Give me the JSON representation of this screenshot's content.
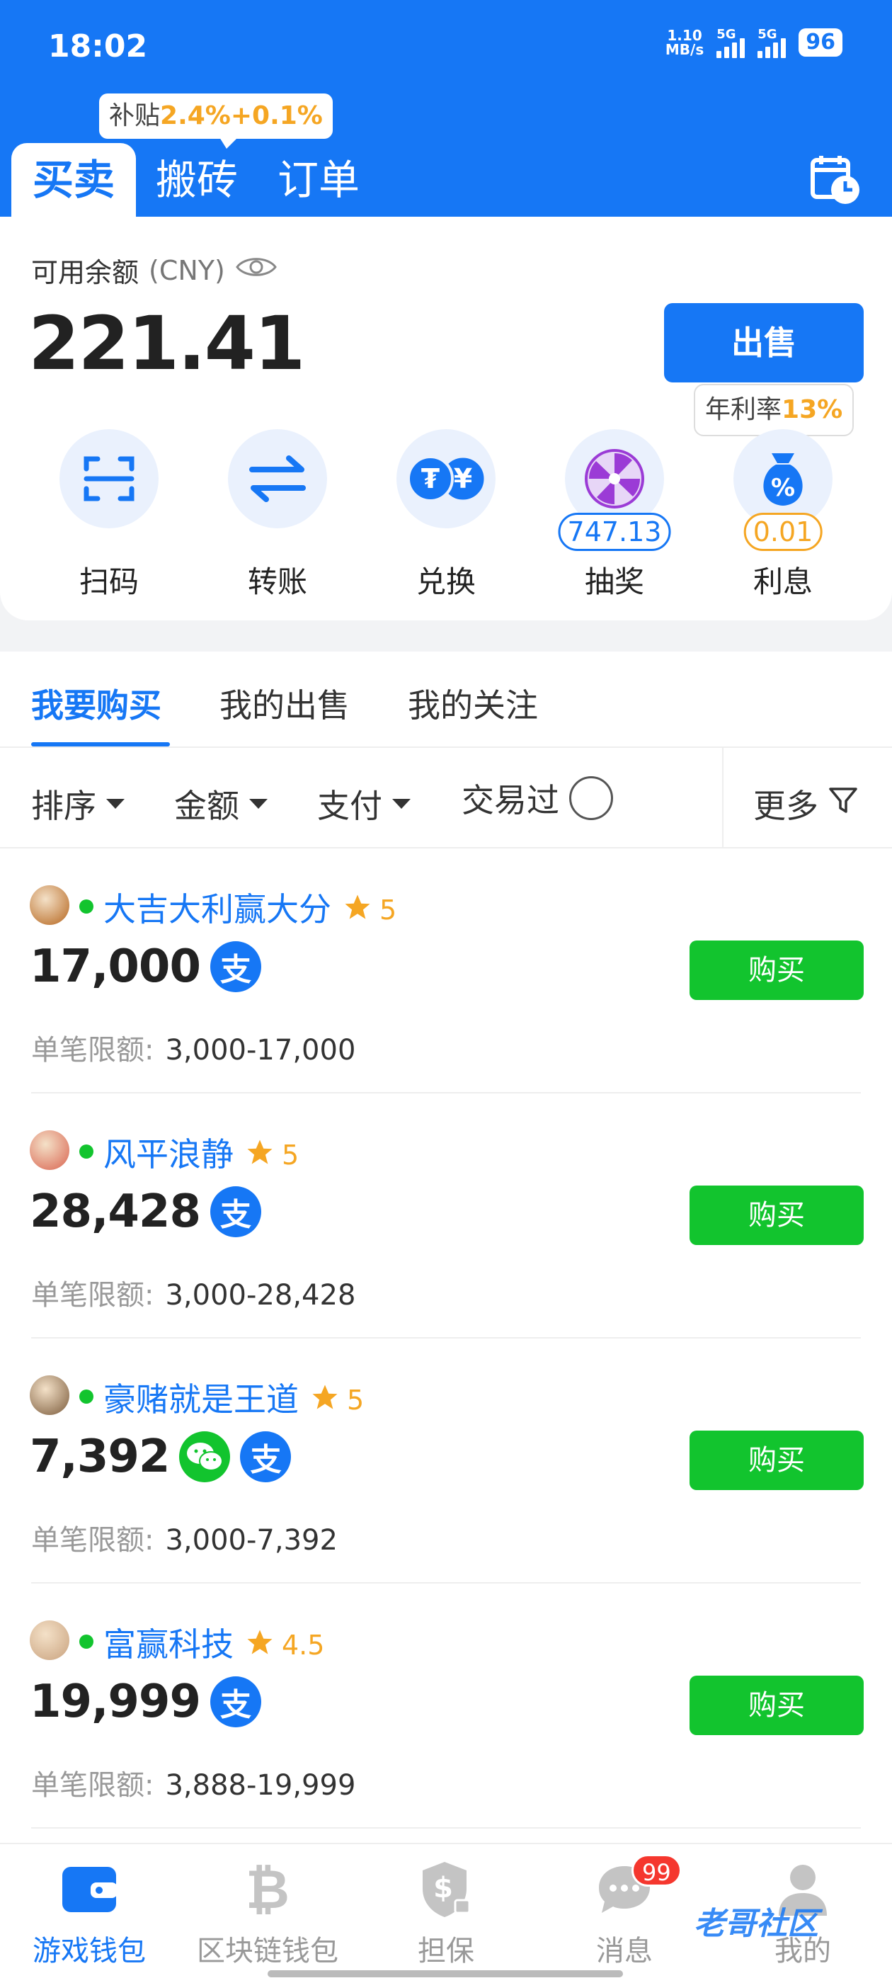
{
  "status_bar": {
    "time": "18:02",
    "net_speed_value": "1.10",
    "net_speed_unit": "MB/s",
    "sim1": "5G",
    "sim2": "5G",
    "battery": "96"
  },
  "header": {
    "subsidy_prefix": "补贴",
    "subsidy_value": "2.4%+0.1%",
    "tabs": [
      "买卖",
      "搬砖",
      "订单"
    ],
    "active_tab": "买卖",
    "history_icon": "calendar-clock-icon"
  },
  "balance": {
    "label": "可用余额",
    "unit": "(CNY)",
    "value": "221.41",
    "sell_label": "出售",
    "rate_prefix": "年利率",
    "rate_value": "13%"
  },
  "actions": [
    {
      "label": "扫码",
      "icon": "scan-icon"
    },
    {
      "label": "转账",
      "icon": "transfer-icon"
    },
    {
      "label": "兑换",
      "icon": "exchange-icon"
    },
    {
      "label": "抽奖",
      "icon": "lottery-wheel-icon",
      "pill": "747.13"
    },
    {
      "label": "利息",
      "icon": "interest-bag-icon",
      "pill": "0.01"
    }
  ],
  "list_tabs": [
    "我要购买",
    "我的出售",
    "我的关注"
  ],
  "filters": {
    "sort": "排序",
    "amount": "金额",
    "payment": "支付",
    "traded": "交易过",
    "more": "更多"
  },
  "offers": [
    {
      "merchant": "大吉大利赢大分",
      "score": "5",
      "amount": "17,000",
      "limit_label": "单笔限额:",
      "limit": "3,000-17,000",
      "methods": [
        "alipay"
      ],
      "buy": "购买",
      "avatar_color": "#b5651d"
    },
    {
      "merchant": "风平浪静",
      "score": "5",
      "amount": "28,428",
      "limit_label": "单笔限额:",
      "limit": "3,000-28,428",
      "methods": [
        "alipay"
      ],
      "buy": "购买",
      "avatar_color": "#d9634f"
    },
    {
      "merchant": "豪赌就是王道",
      "score": "5",
      "amount": "7,392",
      "limit_label": "单笔限额:",
      "limit": "3,000-7,392",
      "methods": [
        "wechat",
        "alipay"
      ],
      "buy": "购买",
      "avatar_color": "#7a5a3a"
    },
    {
      "merchant": "富赢科技",
      "score": "4.5",
      "amount": "19,999",
      "limit_label": "单笔限额:",
      "limit": "3,888-19,999",
      "methods": [
        "alipay"
      ],
      "buy": "购买",
      "avatar_color": "#c9a27e"
    }
  ],
  "payment_glyphs": {
    "alipay": "支",
    "wechat": ""
  },
  "bottom_nav": [
    {
      "label": "游戏钱包",
      "icon": "wallet-icon",
      "active": true
    },
    {
      "label": "区块链钱包",
      "icon": "bitcoin-icon",
      "active": false
    },
    {
      "label": "担保",
      "icon": "shield-dollar-icon",
      "active": false
    },
    {
      "label": "消息",
      "icon": "chat-icon",
      "active": false,
      "badge": "99"
    },
    {
      "label": "我的",
      "icon": "user-icon",
      "active": false
    }
  ],
  "watermark": "老哥社区",
  "colors": {
    "primary": "#1677f5",
    "buy": "#12c42e",
    "accent": "#f5a623",
    "badge": "#f5372e"
  }
}
